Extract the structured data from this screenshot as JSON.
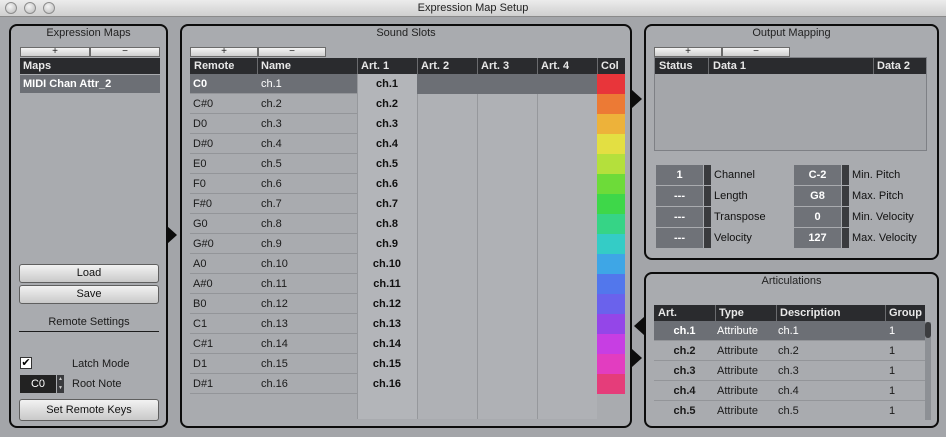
{
  "window": {
    "title": "Expression Map Setup"
  },
  "expression_maps": {
    "title": "Expression Maps",
    "add_label": "+",
    "remove_label": "−",
    "header": "Maps",
    "items": [
      "MIDI Chan Attr_2"
    ],
    "load_label": "Load",
    "save_label": "Save",
    "remote_settings_label": "Remote Settings",
    "latch_mode_label": "Latch Mode",
    "latch_mode_checked": true,
    "checkmark": "✔",
    "root_note_value": "C0",
    "root_note_label": "Root Note",
    "set_remote_keys_label": "Set Remote Keys"
  },
  "sound_slots": {
    "title": "Sound Slots",
    "add_label": "+",
    "remove_label": "−",
    "columns": [
      "Remote",
      "Name",
      "Art. 1",
      "Art. 2",
      "Art. 3",
      "Art. 4",
      "Col"
    ],
    "rows": [
      {
        "remote": "C0",
        "name": "ch.1",
        "art1": "ch.1",
        "color": "#e8353a"
      },
      {
        "remote": "C#0",
        "name": "ch.2",
        "art1": "ch.2",
        "color": "#ec7a35"
      },
      {
        "remote": "D0",
        "name": "ch.3",
        "art1": "ch.3",
        "color": "#edb23a"
      },
      {
        "remote": "D#0",
        "name": "ch.4",
        "art1": "ch.4",
        "color": "#e3df42"
      },
      {
        "remote": "E0",
        "name": "ch.5",
        "art1": "ch.5",
        "color": "#b4e03c"
      },
      {
        "remote": "F0",
        "name": "ch.6",
        "art1": "ch.6",
        "color": "#6ddb39"
      },
      {
        "remote": "F#0",
        "name": "ch.7",
        "art1": "ch.7",
        "color": "#3ed749"
      },
      {
        "remote": "G0",
        "name": "ch.8",
        "art1": "ch.8",
        "color": "#36d486"
      },
      {
        "remote": "G#0",
        "name": "ch.9",
        "art1": "ch.9",
        "color": "#34ccc6"
      },
      {
        "remote": "A0",
        "name": "ch.10",
        "art1": "ch.10",
        "color": "#3ea6e6"
      },
      {
        "remote": "A#0",
        "name": "ch.11",
        "art1": "ch.11",
        "color": "#5277ec"
      },
      {
        "remote": "B0",
        "name": "ch.12",
        "art1": "ch.12",
        "color": "#6a62ec"
      },
      {
        "remote": "C1",
        "name": "ch.13",
        "art1": "ch.13",
        "color": "#9446e8"
      },
      {
        "remote": "C#1",
        "name": "ch.14",
        "art1": "ch.14",
        "color": "#c73ee3"
      },
      {
        "remote": "D1",
        "name": "ch.15",
        "art1": "ch.15",
        "color": "#e23dc0"
      },
      {
        "remote": "D#1",
        "name": "ch.16",
        "art1": "ch.16",
        "color": "#e53d7a"
      }
    ]
  },
  "output_mapping": {
    "title": "Output Mapping",
    "add_label": "+",
    "remove_label": "−",
    "columns": [
      "Status",
      "Data 1",
      "Data 2"
    ],
    "fields_left": [
      {
        "value": "1",
        "label": "Channel"
      },
      {
        "value": "---",
        "label": "Length"
      },
      {
        "value": "---",
        "label": "Transpose"
      },
      {
        "value": "---",
        "label": "Velocity"
      }
    ],
    "fields_right": [
      {
        "value": "C-2",
        "label": "Min. Pitch"
      },
      {
        "value": "G8",
        "label": "Max. Pitch"
      },
      {
        "value": "0",
        "label": "Min. Velocity"
      },
      {
        "value": "127",
        "label": "Max. Velocity"
      }
    ]
  },
  "articulations": {
    "title": "Articulations",
    "columns": [
      "Art.",
      "Type",
      "Description",
      "Group"
    ],
    "rows": [
      {
        "art": "ch.1",
        "type": "Attribute",
        "desc": "ch.1",
        "group": "1"
      },
      {
        "art": "ch.2",
        "type": "Attribute",
        "desc": "ch.2",
        "group": "1"
      },
      {
        "art": "ch.3",
        "type": "Attribute",
        "desc": "ch.3",
        "group": "1"
      },
      {
        "art": "ch.4",
        "type": "Attribute",
        "desc": "ch.4",
        "group": "1"
      },
      {
        "art": "ch.5",
        "type": "Attribute",
        "desc": "ch.5",
        "group": "1"
      }
    ]
  }
}
